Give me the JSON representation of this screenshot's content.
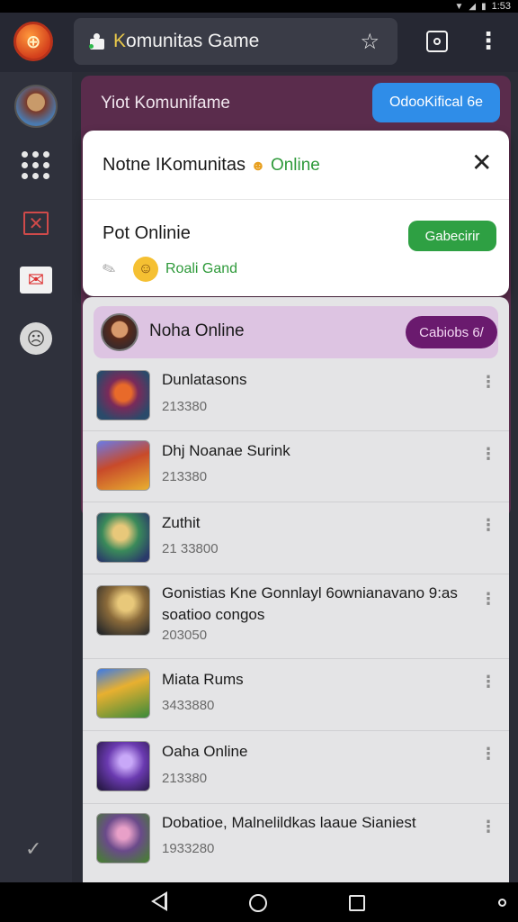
{
  "status_bar": {
    "time": "1:53"
  },
  "top_bar": {
    "url_text_prefix": "K",
    "url_text": "omunitas Game"
  },
  "purple_panel": {
    "title": "Yiot Komunifame",
    "button_label": "OdooKifical 6e"
  },
  "notification": {
    "title": "Notne IKomunitas",
    "status": "Online",
    "subtitle": "Pot Onlinie",
    "action_label": "Gabecirir",
    "reward_text": "Roali Gand",
    "close_icon": "close-icon"
  },
  "list": {
    "header": {
      "title": "Noha Online",
      "button_label": "Cabiobs 6/"
    },
    "items": [
      {
        "name": "Dunlatasons",
        "count": "213380"
      },
      {
        "name": "Dhj Noanae Surink",
        "count": "213380"
      },
      {
        "name": "Zuthit",
        "count": "21 33800"
      },
      {
        "name": "Gonistias Kne Gonnlayl 6ownianavano 9:as soatioo congos",
        "count": "203050"
      },
      {
        "name": "Miata Rums",
        "count": "3433880"
      },
      {
        "name": "Oaha Online",
        "count": "213380"
      },
      {
        "name": "Dobatioe, Malnelildkas laaue Sianiest",
        "count": "1933280"
      }
    ]
  },
  "colors": {
    "brand_purple": "#5a2c4c",
    "accent_blue": "#2f8de8",
    "accent_green": "#2ea043",
    "header_button_purple": "#6a1a6e"
  }
}
